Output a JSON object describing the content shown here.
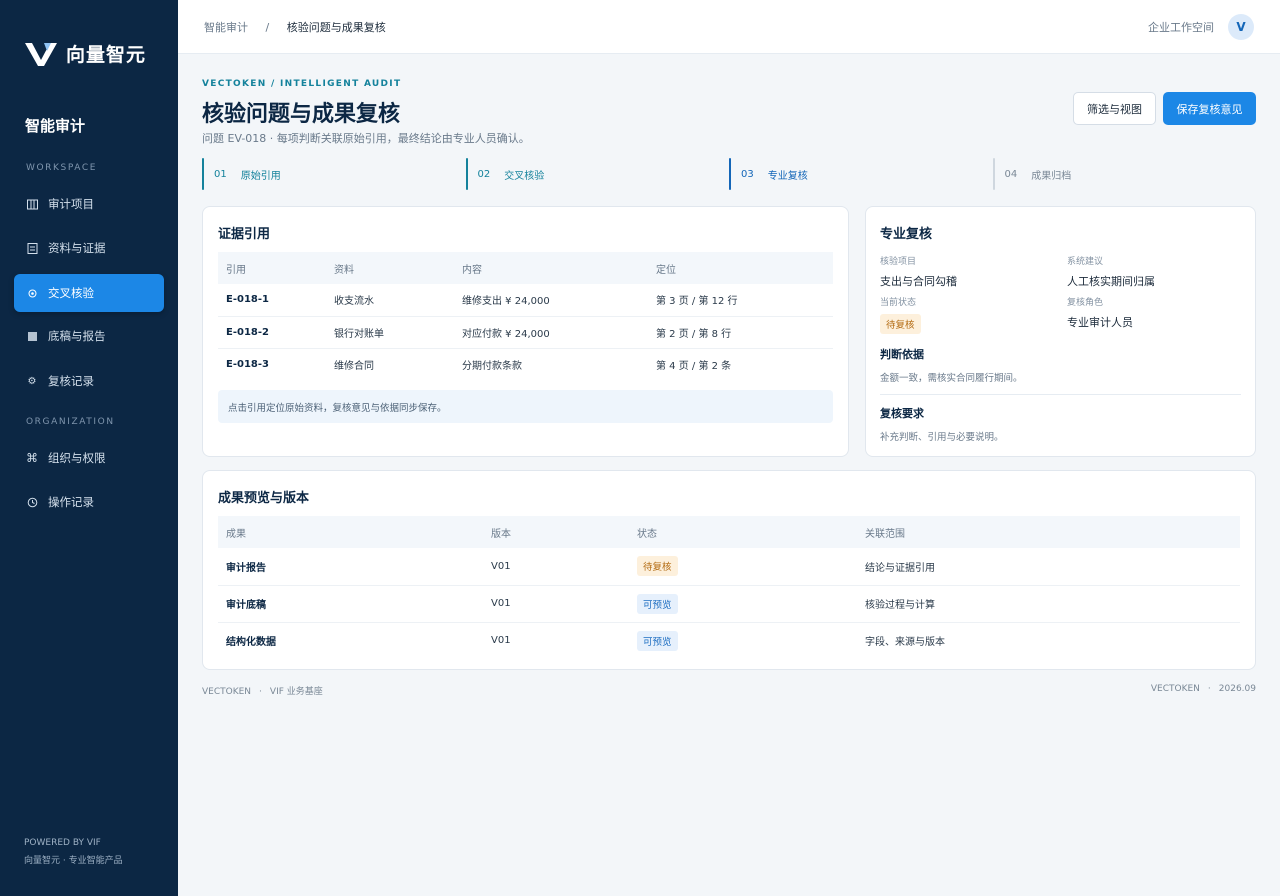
{
  "brand": {
    "name": "向量智元"
  },
  "sidebar": {
    "module_title": "智能审计",
    "workspace_label": "WORKSPACE",
    "organization_label": "ORGANIZATION",
    "items": [
      {
        "label": "审计项目",
        "icon": "columns-icon"
      },
      {
        "label": "资料与证据",
        "icon": "document-icon"
      },
      {
        "label": "交叉核验",
        "icon": "target-icon",
        "active": true
      },
      {
        "label": "底稿与报告",
        "icon": "report-icon"
      },
      {
        "label": "复核记录",
        "icon": "gear-icon"
      }
    ],
    "org_items": [
      {
        "label": "组织与权限",
        "icon": "command-icon"
      },
      {
        "label": "操作记录",
        "icon": "clock-icon"
      }
    ],
    "footer_line1": "POWERED BY VIF",
    "footer_line2": "向量智元 · 专业智能产品"
  },
  "topbar": {
    "crumb_root": "智能审计",
    "crumb_sep": "/",
    "crumb_current": "核验问题与成果复核",
    "workspace": "企业工作空间",
    "avatar": "V"
  },
  "header": {
    "eyebrow": "VECTOKEN / INTELLIGENT AUDIT",
    "title": "核验问题与成果复核",
    "subtitle": "问题 EV-018 · 每项判断关联原始引用，最终结论由专业人员确认。",
    "filter_button": "筛选与视图",
    "save_button": "保存复核意见"
  },
  "steps": [
    {
      "num": "01",
      "label": "原始引用",
      "state": "done"
    },
    {
      "num": "02",
      "label": "交叉核验",
      "state": "done"
    },
    {
      "num": "03",
      "label": "专业复核",
      "state": "active"
    },
    {
      "num": "04",
      "label": "成果归档",
      "state": "todo"
    }
  ],
  "evidence": {
    "title": "证据引用",
    "columns": [
      "引用",
      "资料",
      "内容",
      "定位"
    ],
    "rows": [
      [
        "E-018-1",
        "收支流水",
        "维修支出 ¥ 24,000",
        "第 3 页 / 第 12 行"
      ],
      [
        "E-018-2",
        "银行对账单",
        "对应付款 ¥ 24,000",
        "第 2 页 / 第 8 行"
      ],
      [
        "E-018-3",
        "维修合同",
        "分期付款条款",
        "第 4 页 / 第 2 条"
      ]
    ],
    "notice": "点击引用定位原始资料，复核意见与依据同步保存。"
  },
  "review": {
    "title": "专业复核",
    "item_label": "核验项目",
    "item_value": "支出与合同勾稽",
    "suggest_label": "系统建议",
    "suggest_value": "人工核实期间归属",
    "status_label": "当前状态",
    "status_value": "待复核",
    "role_label": "复核角色",
    "role_value": "专业审计人员",
    "basis_title": "判断依据",
    "basis_text": "金额一致，需核实合同履行期间。",
    "req_title": "复核要求",
    "req_text": "补充判断、引用与必要说明。"
  },
  "results": {
    "title": "成果预览与版本",
    "columns": [
      "成果",
      "版本",
      "状态",
      "关联范围"
    ],
    "rows": [
      {
        "name": "审计报告",
        "version": "V01",
        "status": "待复核",
        "status_type": "warn",
        "scope": "结论与证据引用"
      },
      {
        "name": "审计底稿",
        "version": "V01",
        "status": "可预览",
        "status_type": "info",
        "scope": "核验过程与计算"
      },
      {
        "name": "结构化数据",
        "version": "V01",
        "status": "可预览",
        "status_type": "info",
        "scope": "字段、来源与版本"
      }
    ]
  },
  "footer": {
    "left_a": "VECTOKEN",
    "left_b": "VIF 业务基座",
    "right_a": "VECTOKEN",
    "right_b": "2026.09",
    "sep": "·"
  },
  "colors": {
    "sidebar": "#0c2744",
    "accent": "#1c87e6",
    "teal": "#14829c"
  }
}
